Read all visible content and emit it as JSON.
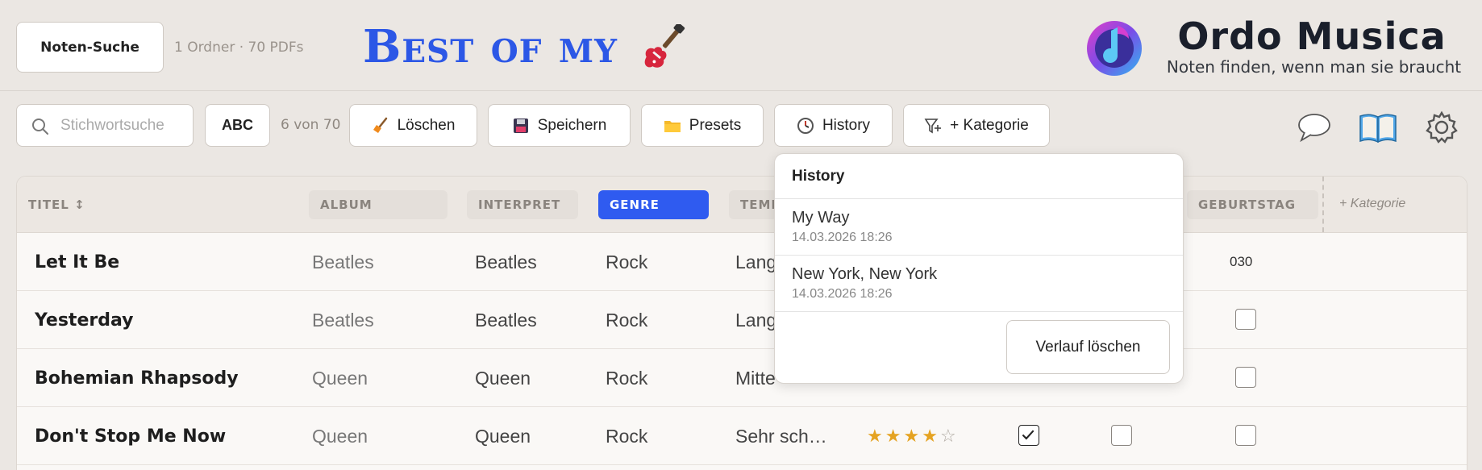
{
  "header": {
    "search_button": "Noten-Suche",
    "folder_info": "1 Ordner · 70 PDFs",
    "banner": "Best of my",
    "brand_name": "Ordo Musica",
    "brand_tagline": "Noten finden, wenn man sie braucht"
  },
  "toolbar": {
    "search_placeholder": "Stichwortsuche",
    "abc_label": "ABC",
    "count": "6 von 70",
    "delete_label": "Löschen",
    "save_label": "Speichern",
    "presets_label": "Presets",
    "history_label": "History",
    "category_label": "+ Kategorie"
  },
  "table": {
    "columns": [
      "TITEL ↕",
      "ALBUM",
      "INTERPRET",
      "GENRE",
      "TEMPO",
      "GEBURTSTAG",
      "+ Kategorie"
    ],
    "active_column": "GENRE",
    "rows": [
      {
        "title": "Let It Be",
        "album": "Beatles",
        "artist": "Beatles",
        "genre": "Rock",
        "tempo": "Lang",
        "birthday": "030"
      },
      {
        "title": "Yesterday",
        "album": "Beatles",
        "artist": "Beatles",
        "genre": "Rock",
        "tempo": "Lang",
        "birthday": ""
      },
      {
        "title": "Bohemian Rhapsody",
        "album": "Queen",
        "artist": "Queen",
        "genre": "Rock",
        "tempo": "Mitte",
        "birthday": ""
      },
      {
        "title": "Don't Stop Me Now",
        "album": "Queen",
        "artist": "Queen",
        "genre": "Rock",
        "tempo": "Sehr sch…",
        "rating": 4,
        "checked": true
      }
    ]
  },
  "history": {
    "title": "History",
    "items": [
      {
        "name": "My Way",
        "date": "14.03.2026 18:26"
      },
      {
        "name": "New York, New York",
        "date": "14.03.2026 18:26"
      }
    ],
    "clear_label": "Verlauf löschen"
  },
  "colors": {
    "accent": "#2f5bf0",
    "background": "#ebe7e3",
    "star": "#e5a322"
  }
}
